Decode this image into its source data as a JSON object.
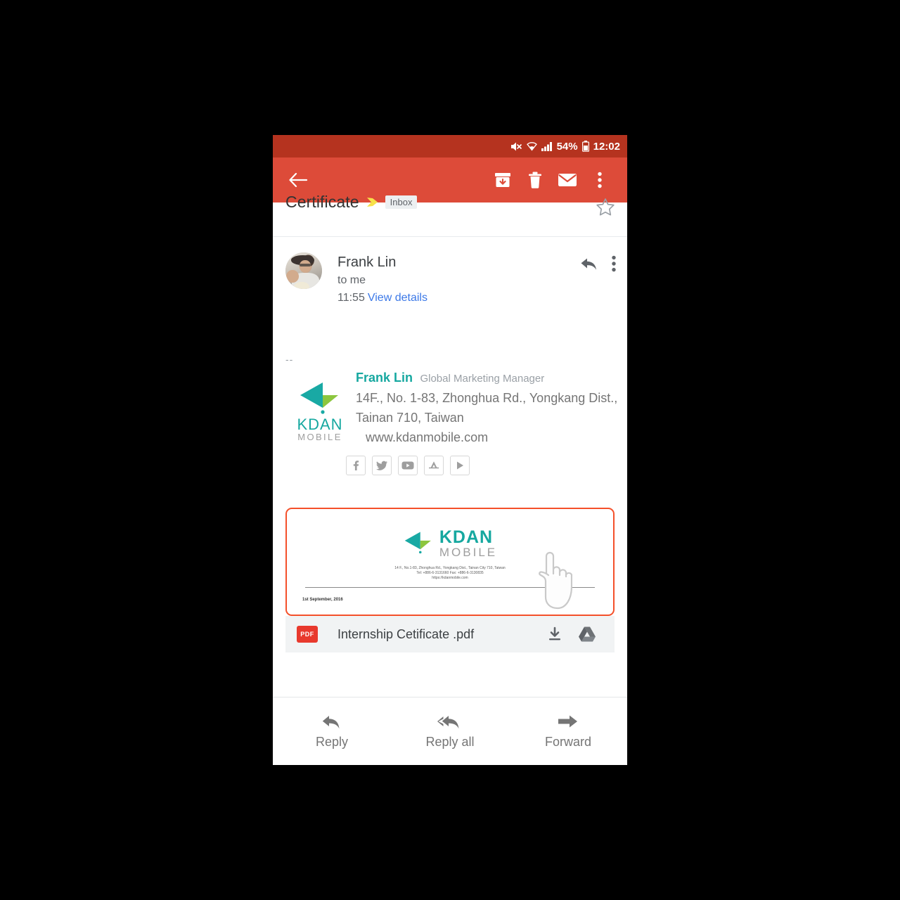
{
  "statusbar": {
    "battery_percent": "54%",
    "time": "12:02",
    "icons": [
      "mute-icon",
      "wifi-icon",
      "signal-icon",
      "battery-icon"
    ]
  },
  "toolbar": {
    "back_label": "back-arrow",
    "actions": [
      {
        "name": "archive-button",
        "label": "Archive"
      },
      {
        "name": "delete-button",
        "label": "Delete"
      },
      {
        "name": "mark-unread-button",
        "label": "Mark unread"
      },
      {
        "name": "more-options-button",
        "label": "More options"
      }
    ]
  },
  "subject": {
    "text": "Certificate",
    "label_chip": "Inbox",
    "importance_marker": "importance-marker-icon",
    "star": "star-outline-icon"
  },
  "sender": {
    "name": "Frank Lin",
    "recipient": "to me",
    "time": "11:55",
    "details_link": "View details",
    "reply_icon": "reply-icon",
    "more_icon": "more-vert-icon"
  },
  "body": {
    "separator": "--",
    "signature": {
      "logo_title": "KDAN",
      "logo_sub": "MOBILE",
      "name": "Frank Lin",
      "title": "Global Marketing Manager",
      "address_line1": "14F., No. 1-83, Zhonghua Rd., Yongkang Dist.,",
      "address_line2": "Tainan 710, Taiwan",
      "website": "www.kdanmobile.com",
      "social": [
        {
          "name": "facebook-icon",
          "label": "f"
        },
        {
          "name": "twitter-icon",
          "label": "Twitter"
        },
        {
          "name": "youtube-icon",
          "label": "YouTube"
        },
        {
          "name": "appstore-icon",
          "label": "App Store"
        },
        {
          "name": "googleplay-icon",
          "label": "Google Play"
        }
      ]
    }
  },
  "preview": {
    "logo_title": "KDAN",
    "logo_sub": "MOBILE",
    "line1": "14 F., No.1-83, Zhonghua Rd., Yongkang Dist., Tainan City 710, Taiwan",
    "line2": "Tel:  +886-6-3131660    Fax:  +886-6-3130835",
    "line3": "https://kdanmobile.com",
    "date": "1st September, 2016",
    "cursor": "pointing-hand-cursor",
    "border_color": "#f4502a"
  },
  "attachment": {
    "file_type": "PDF",
    "filename": "Internship Cetificate .pdf",
    "download_icon": "download-icon",
    "drive_icon": "google-drive-icon"
  },
  "bottombar": {
    "buttons": [
      {
        "name": "reply-button",
        "label": "Reply",
        "icon": "reply-icon"
      },
      {
        "name": "reply-all-button",
        "label": "Reply all",
        "icon": "reply-all-icon"
      },
      {
        "name": "forward-button",
        "label": "Forward",
        "icon": "forward-icon"
      }
    ]
  },
  "colors": {
    "toolbar": "#dd4b39",
    "statusbar": "#b5331f",
    "accent_teal": "#16a8a0",
    "link_blue": "#3b78e7",
    "highlight": "#f4502a"
  }
}
